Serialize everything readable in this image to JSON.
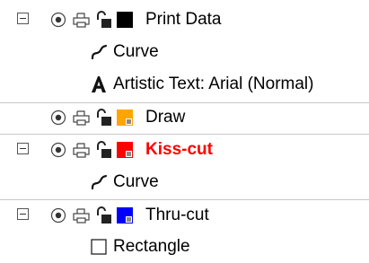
{
  "layers": [
    {
      "label": "Print Data",
      "swatch_color": "#000000",
      "expanded": true,
      "children": [
        {
          "icon": "curve-icon",
          "label": "Curve"
        },
        {
          "icon": "artistic-text-icon",
          "label": "Artistic Text: Arial (Normal)"
        }
      ]
    },
    {
      "label": "Draw",
      "swatch_color": "#ffa500",
      "expanded": false,
      "children": []
    },
    {
      "label": "Kiss-cut",
      "swatch_color": "#ff0000",
      "expanded": true,
      "label_color": "#ff0000",
      "children": [
        {
          "icon": "curve-icon",
          "label": "Curve"
        }
      ]
    },
    {
      "label": "Thru-cut",
      "swatch_color": "#0000ff",
      "expanded": true,
      "children": [
        {
          "icon": "rectangle-icon",
          "label": "Rectangle"
        }
      ]
    }
  ]
}
